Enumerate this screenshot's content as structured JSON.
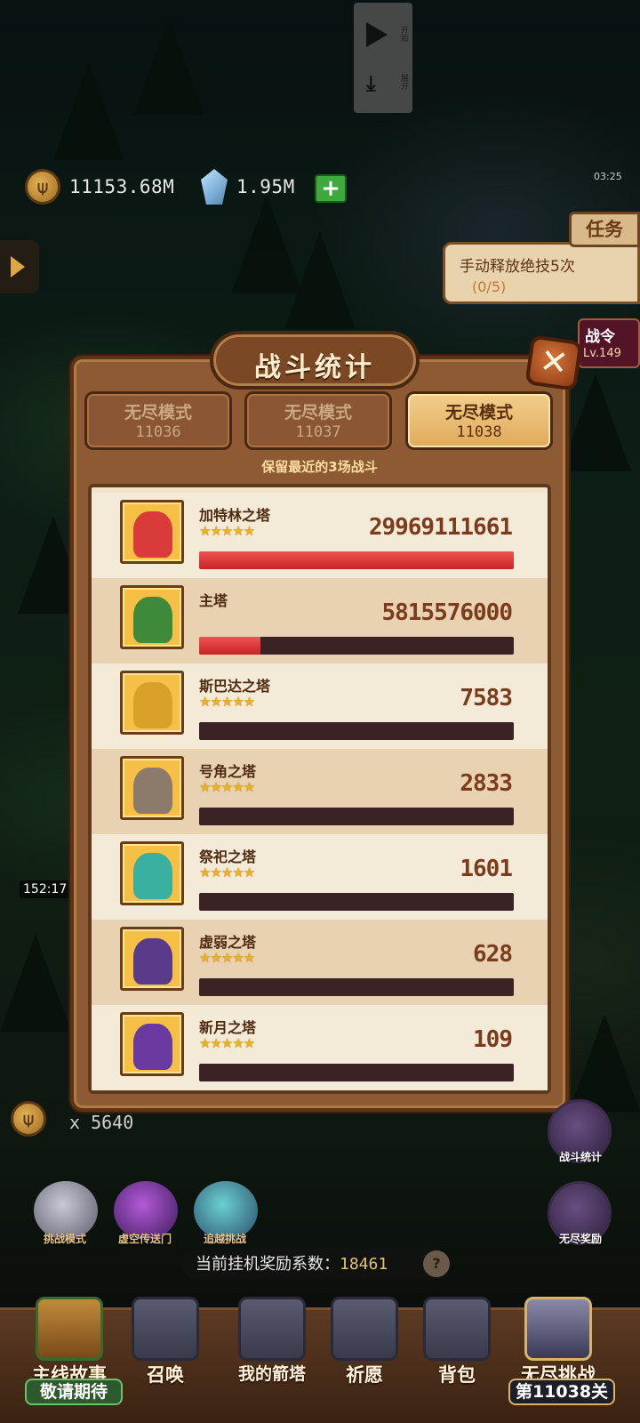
{
  "media_control": {
    "play_label": "开始",
    "collapse_label": "展开"
  },
  "currency": {
    "gold": "11153.68M",
    "gems": "1.95M"
  },
  "quest": {
    "tab_label": "任务",
    "text": "手动释放绝技5次",
    "progress": "(0/5)"
  },
  "battle_pass": {
    "title": "战令",
    "level": "Lv.149"
  },
  "timers": {
    "top_right": "03:25",
    "left_hero": "152:17"
  },
  "modal": {
    "title": "战斗统计",
    "tabs": [
      {
        "mode": "无尽模式",
        "number": "11036",
        "active": false
      },
      {
        "mode": "无尽模式",
        "number": "11037",
        "active": false
      },
      {
        "mode": "无尽模式",
        "number": "11038",
        "active": true
      }
    ],
    "note": "保留最近的3场战斗",
    "towers": [
      {
        "name": "加特林之塔",
        "stars": "★★★★★",
        "damage": "29969111661",
        "bar_fraction": 1.0,
        "show_stars": true
      },
      {
        "name": "主塔",
        "stars": "",
        "damage": "5815576000",
        "bar_fraction": 0.194,
        "show_stars": false
      },
      {
        "name": "斯巴达之塔",
        "stars": "★★★★★",
        "damage": "7583",
        "bar_fraction": 0.0,
        "show_stars": true
      },
      {
        "name": "号角之塔",
        "stars": "★★★★★",
        "damage": "2833",
        "bar_fraction": 0.0,
        "show_stars": true
      },
      {
        "name": "祭祀之塔",
        "stars": "★★★★★",
        "damage": "1601",
        "bar_fraction": 0.0,
        "show_stars": true
      },
      {
        "name": "虚弱之塔",
        "stars": "★★★★★",
        "damage": "628",
        "bar_fraction": 0.0,
        "show_stars": true
      },
      {
        "name": "新月之塔",
        "stars": "★★★★★",
        "damage": "109",
        "bar_fraction": 0.0,
        "show_stars": true
      }
    ]
  },
  "hud": {
    "coin_count": "x 5640",
    "battle_stats_label": "战斗统计",
    "endless_reward_label": "无尽奖励",
    "mini_buttons": [
      "挑战模式",
      "虚空传送门",
      "追越挑战"
    ],
    "reward_coef_label": "当前挂机奖励系数：",
    "reward_coef_value": "18461",
    "reward_help": "?"
  },
  "bottom_nav": [
    {
      "label": "主线故事",
      "badge": "敬请期待"
    },
    {
      "label": "召唤"
    },
    {
      "label": "我的箭塔"
    },
    {
      "label": "祈愿"
    },
    {
      "label": "背包"
    },
    {
      "label": "无尽挑战",
      "badge": "第11038关"
    }
  ],
  "colors": {
    "panel_brown": "#8d5a33",
    "list_bg": "#f1e3cb",
    "bar_fill": "#d62f2f",
    "bar_empty": "#3a2225",
    "damage_text": "#7a3c1c",
    "active_tab": "#e0a95a"
  }
}
